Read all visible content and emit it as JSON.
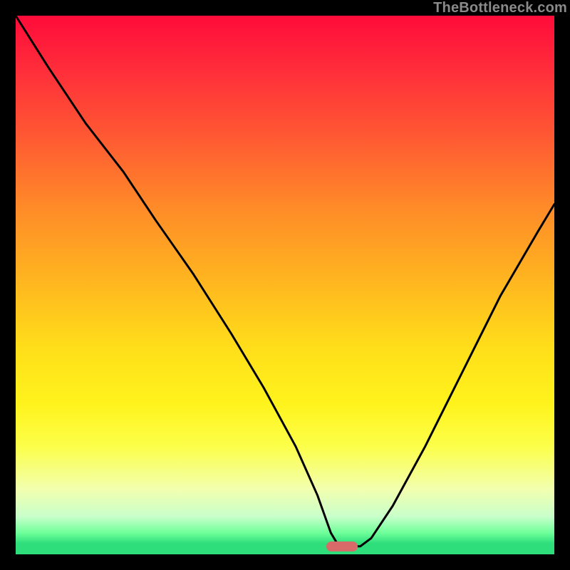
{
  "watermark": "TheBottleneck.com",
  "marker": {
    "x_frac": 0.606,
    "y_frac": 0.985
  },
  "chart_data": {
    "type": "line",
    "title": "",
    "xlabel": "",
    "ylabel": "",
    "xlim": [
      0,
      1
    ],
    "ylim": [
      0,
      1
    ],
    "note": "Axes have no visible tick labels; values are normalized 0–1 fractions of the plot area. y is plotted with 0 at top (higher value = lower on screen).",
    "series": [
      {
        "name": "bottleneck-curve",
        "x": [
          0.0,
          0.06,
          0.13,
          0.2,
          0.26,
          0.33,
          0.4,
          0.46,
          0.52,
          0.56,
          0.585,
          0.6,
          0.64,
          0.66,
          0.7,
          0.76,
          0.83,
          0.9,
          0.97,
          1.0
        ],
        "y": [
          0.0,
          0.095,
          0.2,
          0.29,
          0.38,
          0.48,
          0.59,
          0.69,
          0.8,
          0.89,
          0.96,
          0.985,
          0.985,
          0.97,
          0.91,
          0.8,
          0.66,
          0.52,
          0.4,
          0.35
        ]
      }
    ],
    "gradient_stops": [
      {
        "pos": 0.0,
        "color": "#ff0b3a"
      },
      {
        "pos": 0.1,
        "color": "#ff2d3a"
      },
      {
        "pos": 0.22,
        "color": "#ff5733"
      },
      {
        "pos": 0.36,
        "color": "#ff8c28"
      },
      {
        "pos": 0.5,
        "color": "#ffb81f"
      },
      {
        "pos": 0.62,
        "color": "#ffdf1a"
      },
      {
        "pos": 0.72,
        "color": "#fff31c"
      },
      {
        "pos": 0.8,
        "color": "#fcff4a"
      },
      {
        "pos": 0.88,
        "color": "#f2ffb0"
      },
      {
        "pos": 0.93,
        "color": "#c8ffca"
      },
      {
        "pos": 0.96,
        "color": "#6fff9a"
      },
      {
        "pos": 0.98,
        "color": "#2dde7a"
      },
      {
        "pos": 1.0,
        "color": "#2dde7a"
      }
    ]
  }
}
